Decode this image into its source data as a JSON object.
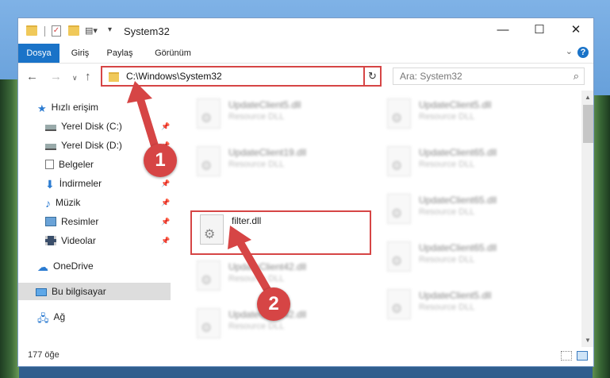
{
  "window": {
    "title": "System32",
    "controls": {
      "minimize": "—",
      "maximize": "☐",
      "close": "✕"
    }
  },
  "ribbon": {
    "tabs": [
      {
        "label": "Dosya",
        "active": true
      },
      {
        "label": "Giriş"
      },
      {
        "label": "Paylaş"
      },
      {
        "label": "Görünüm"
      }
    ],
    "help": "?"
  },
  "nav": {
    "back": "←",
    "forward": "→",
    "recent": "∨",
    "up": "↑",
    "address": "C:\\Windows\\System32",
    "search_placeholder": "Ara: System32"
  },
  "sidebar": {
    "items": [
      {
        "label": "Hızlı erişim",
        "icon": "star-icon"
      },
      {
        "label": "Yerel Disk (C:)",
        "icon": "drive-icon",
        "pinned": true
      },
      {
        "label": "Yerel Disk (D:)",
        "icon": "drive-icon",
        "pinned": true
      },
      {
        "label": "Belgeler",
        "icon": "documents-icon",
        "pinned": true
      },
      {
        "label": "İndirmeler",
        "icon": "download-icon",
        "pinned": true
      },
      {
        "label": "Müzik",
        "icon": "music-icon",
        "pinned": true
      },
      {
        "label": "Resimler",
        "icon": "pictures-icon",
        "pinned": true
      },
      {
        "label": "Videolar",
        "icon": "videos-icon",
        "pinned": true
      },
      {
        "label": "OneDrive",
        "icon": "cloud-icon"
      },
      {
        "label": "Bu bilgisayar",
        "icon": "computer-icon",
        "selected": true
      },
      {
        "label": "Ağ",
        "icon": "network-icon"
      }
    ]
  },
  "files": {
    "left": [
      {
        "name": "UpdateClient5.dll",
        "type": "Resource DLL",
        "blurred": true
      },
      {
        "name": "UpdateClient19.dll",
        "type": "Resource DLL",
        "blurred": true
      },
      {
        "name": "filter.dll",
        "type": "",
        "blurred": false
      },
      {
        "name": "UpdateClient42.dll",
        "type": "Resource DLL",
        "blurred": true
      },
      {
        "name": "UpdateClient42.dll",
        "type": "Resource DLL",
        "blurred": true
      }
    ],
    "right": [
      {
        "name": "UpdateClient5.dll",
        "type": "Resource DLL"
      },
      {
        "name": "UpdateClient65.dll",
        "type": "Resource DLL"
      },
      {
        "name": "UpdateClient65.dll",
        "type": "Resource DLL"
      },
      {
        "name": "UpdateClient65.dll",
        "type": "Resource DLL"
      },
      {
        "name": "UpdateClient5.dll",
        "type": "Resource DLL"
      }
    ]
  },
  "status": {
    "count": "177 öğe"
  },
  "annotations": {
    "step1": "1",
    "step2": "2",
    "accent": "#d64545"
  }
}
